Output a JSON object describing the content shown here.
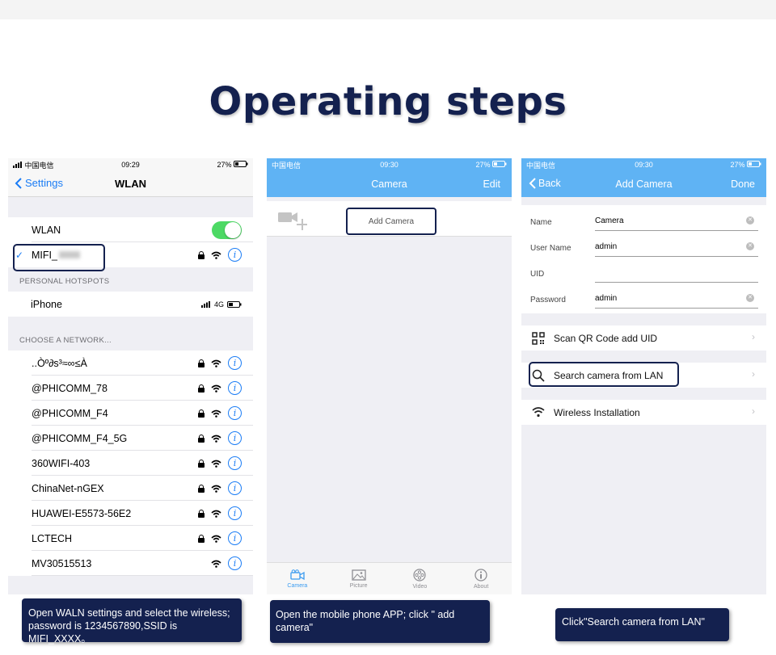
{
  "title": "Operating steps",
  "phone1": {
    "status": {
      "carrier": "中国电信",
      "time": "09:29",
      "battery": "27%"
    },
    "nav": {
      "back": "Settings",
      "title": "WLAN"
    },
    "wlan_label": "WLAN",
    "connected": "MIFI_",
    "hotspots_header": "PERSONAL HOTSPOTS",
    "hotspot": {
      "name": "iPhone",
      "signal": "4G"
    },
    "choose_header": "CHOOSE A NETWORK...",
    "networks": [
      {
        "name": "..Òº∂s³≈∞≤À",
        "locked": true
      },
      {
        "name": "@PHICOMM_78",
        "locked": true
      },
      {
        "name": "@PHICOMM_F4",
        "locked": true
      },
      {
        "name": "@PHICOMM_F4_5G",
        "locked": true
      },
      {
        "name": "360WIFI-403",
        "locked": true
      },
      {
        "name": "ChinaNet-nGEX",
        "locked": true
      },
      {
        "name": "HUAWEI-E5573-56E2",
        "locked": true
      },
      {
        "name": "LCTECH",
        "locked": true
      },
      {
        "name": "MV30515513",
        "locked": false
      }
    ]
  },
  "phone2": {
    "status": {
      "carrier": "中国电信",
      "time": "09:30",
      "battery": "27%"
    },
    "nav": {
      "title": "Camera",
      "edit": "Edit"
    },
    "add_camera": "Add Camera",
    "tabs": [
      {
        "label": "Camera",
        "icon": "camera-icon",
        "active": true
      },
      {
        "label": "Picture",
        "icon": "picture-icon",
        "active": false
      },
      {
        "label": "Video",
        "icon": "video-icon",
        "active": false
      },
      {
        "label": "About",
        "icon": "about-icon",
        "active": false
      }
    ]
  },
  "phone3": {
    "status": {
      "carrier": "中国电信",
      "time": "09:30",
      "battery": "27%"
    },
    "nav": {
      "back": "Back",
      "title": "Add Camera",
      "done": "Done"
    },
    "fields": [
      {
        "label": "Name",
        "value": "Camera",
        "clear": true
      },
      {
        "label": "User Name",
        "value": "admin",
        "clear": true
      },
      {
        "label": "UID",
        "value": "",
        "clear": false
      },
      {
        "label": "Password",
        "value": "admin",
        "clear": true
      }
    ],
    "options": [
      {
        "label": "Scan QR Code add UID",
        "icon": "qr-code-icon"
      },
      {
        "label": "Search camera from LAN",
        "icon": "search-icon"
      },
      {
        "label": "Wireless Installation",
        "icon": "wifi-icon"
      }
    ]
  },
  "captions": {
    "step1": "Open WALN settings and select the wireless; password is 1234567890,SSID is MIFI_XXXX。",
    "step2": "Open the mobile phone APP; click \" add camera\"",
    "step3": "Click\"Search camera from LAN\""
  },
  "colors": {
    "navy": "#14214f",
    "app_blue": "#5fb3f4",
    "ios_blue": "#1a7cf5",
    "toggle_green": "#4cd964"
  }
}
